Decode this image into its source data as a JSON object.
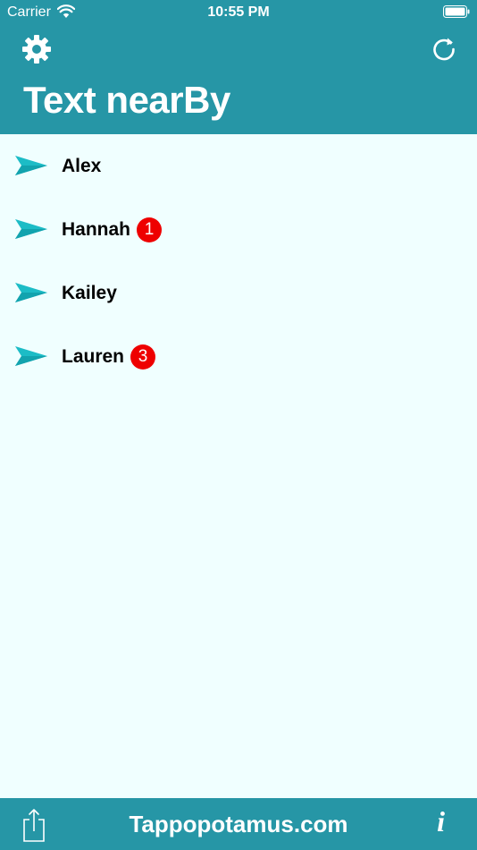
{
  "status_bar": {
    "carrier": "Carrier",
    "time": "10:55 PM"
  },
  "header": {
    "title": "Text nearBy",
    "settings_icon": "gear-icon",
    "refresh_icon": "refresh-icon"
  },
  "contacts": [
    {
      "name": "Alex",
      "badge": null
    },
    {
      "name": "Hannah",
      "badge": "1"
    },
    {
      "name": "Kailey",
      "badge": null
    },
    {
      "name": "Lauren",
      "badge": "3"
    }
  ],
  "footer": {
    "link": "Tappopotamus.com",
    "share_icon": "share-icon",
    "info_label": "i"
  },
  "colors": {
    "bar": "#2696a6",
    "background": "#f0ffff",
    "badge": "#ee0000",
    "send_icon": "#1cbcc6"
  }
}
